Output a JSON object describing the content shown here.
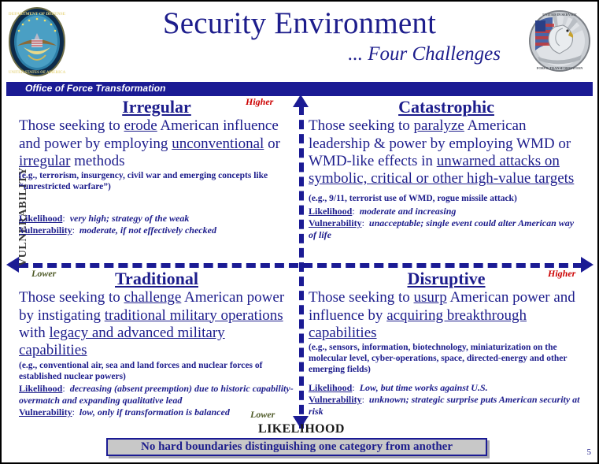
{
  "header": {
    "title": "Security Environment",
    "subtitle": "... Four Challenges",
    "left_seal_name": "dod-seal",
    "right_seal_name": "office-of-force-transformation-seal",
    "banner_label": "Office of Force Transformation",
    "banner_color": "#1b1b94",
    "title_color": "#1d1d8c"
  },
  "axes": {
    "vertical_label": "VULNERABILITY",
    "horizontal_label": "LIKELIHOOD",
    "top_tag": "Higher",
    "bottom_tag": "Lower",
    "left_tag": "Lower",
    "right_tag": "Higher",
    "higher_color": "#cc0000",
    "lower_color": "#4e5a27",
    "axis_line_color": "#1b1b94"
  },
  "quadrants": {
    "irregular": {
      "title": "Irregular",
      "desc_parts": [
        {
          "t": "Those seeking to ",
          "u": false
        },
        {
          "t": "erode",
          "u": true
        },
        {
          "t": " American influence and power by employing ",
          "u": false
        },
        {
          "t": "unconventional",
          "u": true
        },
        {
          "t": " or ",
          "u": false
        },
        {
          "t": "irregular",
          "u": true
        },
        {
          "t": " methods",
          "u": false
        }
      ],
      "example": "(e.g., terrorism, insurgency, civil war and emerging concepts like “unrestricted warfare”)",
      "likelihood_key": "Likelihood",
      "likelihood_value": "very high; strategy of the weak",
      "vulnerability_key": "Vulnerability",
      "vulnerability_value": "moderate, if not effectively checked"
    },
    "catastrophic": {
      "title": "Catastrophic",
      "desc_parts": [
        {
          "t": "Those seeking to ",
          "u": false
        },
        {
          "t": "paralyze",
          "u": true
        },
        {
          "t": " American leadership & power by employing WMD or WMD-like effects in ",
          "u": false
        },
        {
          "t": "unwarned attacks on symbolic, critical or other high-value targets",
          "u": true
        }
      ],
      "example": "(e.g., 9/11, terrorist use of WMD, rogue missile attack)",
      "likelihood_key": "Likelihood",
      "likelihood_value": "moderate and increasing",
      "vulnerability_key": "Vulnerability",
      "vulnerability_value": "unacceptable; single event could alter American way of life"
    },
    "traditional": {
      "title": "Traditional",
      "desc_parts": [
        {
          "t": "Those seeking to ",
          "u": false
        },
        {
          "t": "challenge",
          "u": true
        },
        {
          "t": " American power by instigating ",
          "u": false
        },
        {
          "t": "traditional military operations",
          "u": true
        },
        {
          "t": " with ",
          "u": false
        },
        {
          "t": "legacy and advanced military capabilities",
          "u": true
        }
      ],
      "example": "(e.g., conventional air, sea and land forces and nuclear forces of established nuclear powers)",
      "likelihood_key": "Likelihood",
      "likelihood_value": "decreasing (absent preemption) due to historic capability-overmatch and expanding qualitative lead",
      "vulnerability_key": "Vulnerability",
      "vulnerability_value": "low, only if transformation is balanced"
    },
    "disruptive": {
      "title": "Disruptive",
      "desc_parts": [
        {
          "t": "Those seeking to ",
          "u": false
        },
        {
          "t": "usurp",
          "u": true
        },
        {
          "t": " American power and influence by ",
          "u": false
        },
        {
          "t": "acquiring breakthrough capabilities",
          "u": true
        }
      ],
      "example": "(e.g., sensors, information, biotechnology, miniaturization on the molecular level, cyber-operations, space, directed-energy and other emerging fields)",
      "likelihood_key": "Likelihood",
      "likelihood_value": "Low, but time works against U.S.",
      "vulnerability_key": "Vulnerability",
      "vulnerability_value": "unknown; strategic surprise puts American security at risk"
    }
  },
  "footer": {
    "note": "No hard boundaries distinguishing one category from another",
    "page_number": "5",
    "note_bg": "#c8c8c8",
    "note_border": "#1b1b94"
  }
}
